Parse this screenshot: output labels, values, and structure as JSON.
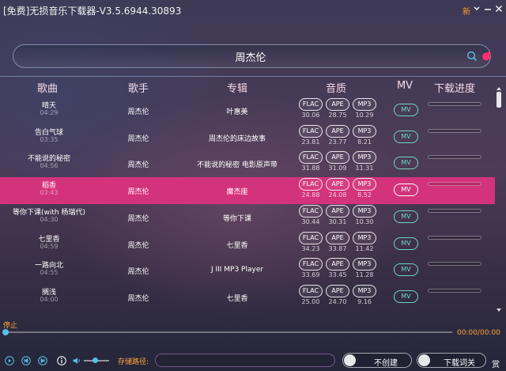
{
  "app_title": "[免费]无损音乐下载器-V3.5.6944.30893",
  "new_badge": "新",
  "search": {
    "value": "周杰伦",
    "placeholder": ""
  },
  "headers": {
    "song": "歌曲",
    "artist": "歌手",
    "album": "专辑",
    "quality": "音质",
    "mv": "MV",
    "progress": "下载进度"
  },
  "songs": [
    {
      "name": "晴天",
      "duration": "04:29",
      "artist": "周杰伦",
      "album": "叶惠美",
      "flac": "FLAC",
      "ape": "APE",
      "mp3": "MP3",
      "flac_size": "30.06",
      "ape_size": "28.75",
      "mp3_size": "10.29",
      "mv": "MV"
    },
    {
      "name": "告白气球",
      "duration": "03:35",
      "artist": "周杰伦",
      "album": "周杰伦的床边故事",
      "flac": "FLAC",
      "ape": "APE",
      "mp3": "MP3",
      "flac_size": "23.81",
      "ape_size": "23.77",
      "mp3_size": "8.21",
      "mv": "MV"
    },
    {
      "name": "不能说的秘密",
      "duration": "04:56",
      "artist": "周杰伦",
      "album": "不能说的秘密 电影原声带",
      "flac": "FLAC",
      "ape": "APE",
      "mp3": "MP3",
      "flac_size": "31.88",
      "ape_size": "31.09",
      "mp3_size": "11.31",
      "mv": "MV"
    },
    {
      "name": "稻香",
      "duration": "03:43",
      "artist": "周杰伦",
      "album": "魔杰座",
      "flac": "FLAC",
      "ape": "APE",
      "mp3": "MP3",
      "flac_size": "24.88",
      "ape_size": "24.08",
      "mp3_size": "8.52",
      "mv": "MV"
    },
    {
      "name": "等你下课(with 杨瑞代)",
      "duration": "04:30",
      "artist": "周杰伦",
      "album": "等你下课",
      "flac": "FLAC",
      "ape": "APE",
      "mp3": "MP3",
      "flac_size": "30.44",
      "ape_size": "30.31",
      "mp3_size": "10.30",
      "mv": "MV"
    },
    {
      "name": "七里香",
      "duration": "04:59",
      "artist": "周杰伦",
      "album": "七里香",
      "flac": "FLAC",
      "ape": "APE",
      "mp3": "MP3",
      "flac_size": "34.23",
      "ape_size": "33.87",
      "mp3_size": "11.42",
      "mv": "MV"
    },
    {
      "name": "一路向北",
      "duration": "04:55",
      "artist": "周杰伦",
      "album": "J III MP3 Player",
      "flac": "FLAC",
      "ape": "APE",
      "mp3": "MP3",
      "flac_size": "33.69",
      "ape_size": "33.45",
      "mp3_size": "11.28",
      "mv": "MV"
    },
    {
      "name": "搁浅",
      "duration": "04:00",
      "artist": "周杰伦",
      "album": "七里香",
      "flac": "FLAC",
      "ape": "APE",
      "mp3": "MP3",
      "flac_size": "25.00",
      "ape_size": "24.70",
      "mp3_size": "9.16",
      "mv": "MV"
    }
  ],
  "selected_index": 3,
  "player": {
    "status": "停止",
    "time": "00:00/00:00"
  },
  "bottom": {
    "save_path_label": "存储路径:",
    "save_path_value": "",
    "create_folder": "不创建",
    "lyrics": "下载词关",
    "reward": "赏"
  },
  "colors": {
    "selected_row": "#d3337b",
    "accent_orange": "#ffa53a",
    "mv_teal": "#6fd7c0",
    "seek_blue": "#58c0e8"
  }
}
